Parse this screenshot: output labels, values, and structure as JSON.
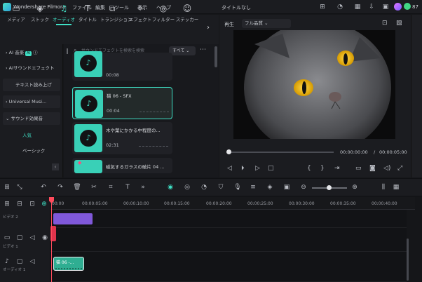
{
  "titlebar": {
    "app_name": "Wondershare Filmora",
    "menu": [
      "ファイル",
      "編集",
      "ツール",
      "表示",
      "ヘルプ"
    ],
    "title": "タイトルなし",
    "credits": "87"
  },
  "toolbar": {
    "tabs": [
      {
        "label": "メディア",
        "icon": "media-icon"
      },
      {
        "label": "ストック",
        "icon": "stock-icon"
      },
      {
        "label": "オーディオ",
        "icon": "music-note-icon",
        "active": true
      },
      {
        "label": "タイトル",
        "icon": "title-icon"
      },
      {
        "label": "トランジション",
        "icon": "transition-icon"
      },
      {
        "label": "エフェクト",
        "icon": "effect-icon"
      },
      {
        "label": "フィルター",
        "icon": "filter-icon"
      },
      {
        "label": "ステッカー",
        "icon": "sticker-icon"
      }
    ]
  },
  "sidebar": {
    "items": [
      {
        "label": "AI 音楽",
        "badge": "AI"
      },
      {
        "label": "AIサウンドエフェクト",
        "badge": "AI"
      },
      {
        "label": "テキスト読み上げ"
      },
      {
        "label": "Universal Musi..."
      },
      {
        "label": "サウンド効果音"
      },
      {
        "label": "人気"
      },
      {
        "label": "ベーシック"
      }
    ]
  },
  "content": {
    "search_placeholder": "サウンドエフェクトを検索を検索",
    "filter_label": "すべて",
    "cards": [
      {
        "title": "",
        "duration": "00:08"
      },
      {
        "title": "猫 06 - SFX",
        "duration": "00:04",
        "selected": true
      },
      {
        "title": "木や葉にかかる中程度の...",
        "duration": "02:31"
      },
      {
        "title": "磁気するガラスの破片 04 ...",
        "duration": ""
      }
    ]
  },
  "preview": {
    "label": "再生",
    "quality": "フル品質",
    "time_current": "00:00:00:00",
    "time_total": "00:00:05:00",
    "separator": "/"
  },
  "timeline": {
    "ruler": [
      "00:00",
      "00:00:05:00",
      "00:00:10:00",
      "00:00:15:00",
      "00:00:20:00",
      "00:00:25:00",
      "00:00:30:00",
      "00:00:35:00",
      "00:00:40:00"
    ],
    "tracks": [
      {
        "label": "ビデオ 2"
      },
      {
        "label": "ビデオ 1"
      },
      {
        "label": "オーディオ 1"
      }
    ],
    "audio_clip_label": "猫 06 -..."
  },
  "colors": {
    "accent": "#3fe0c5",
    "clip_video": "#7f58d9",
    "clip_audio": "#2fae92",
    "playhead": "#ff4b5c"
  }
}
